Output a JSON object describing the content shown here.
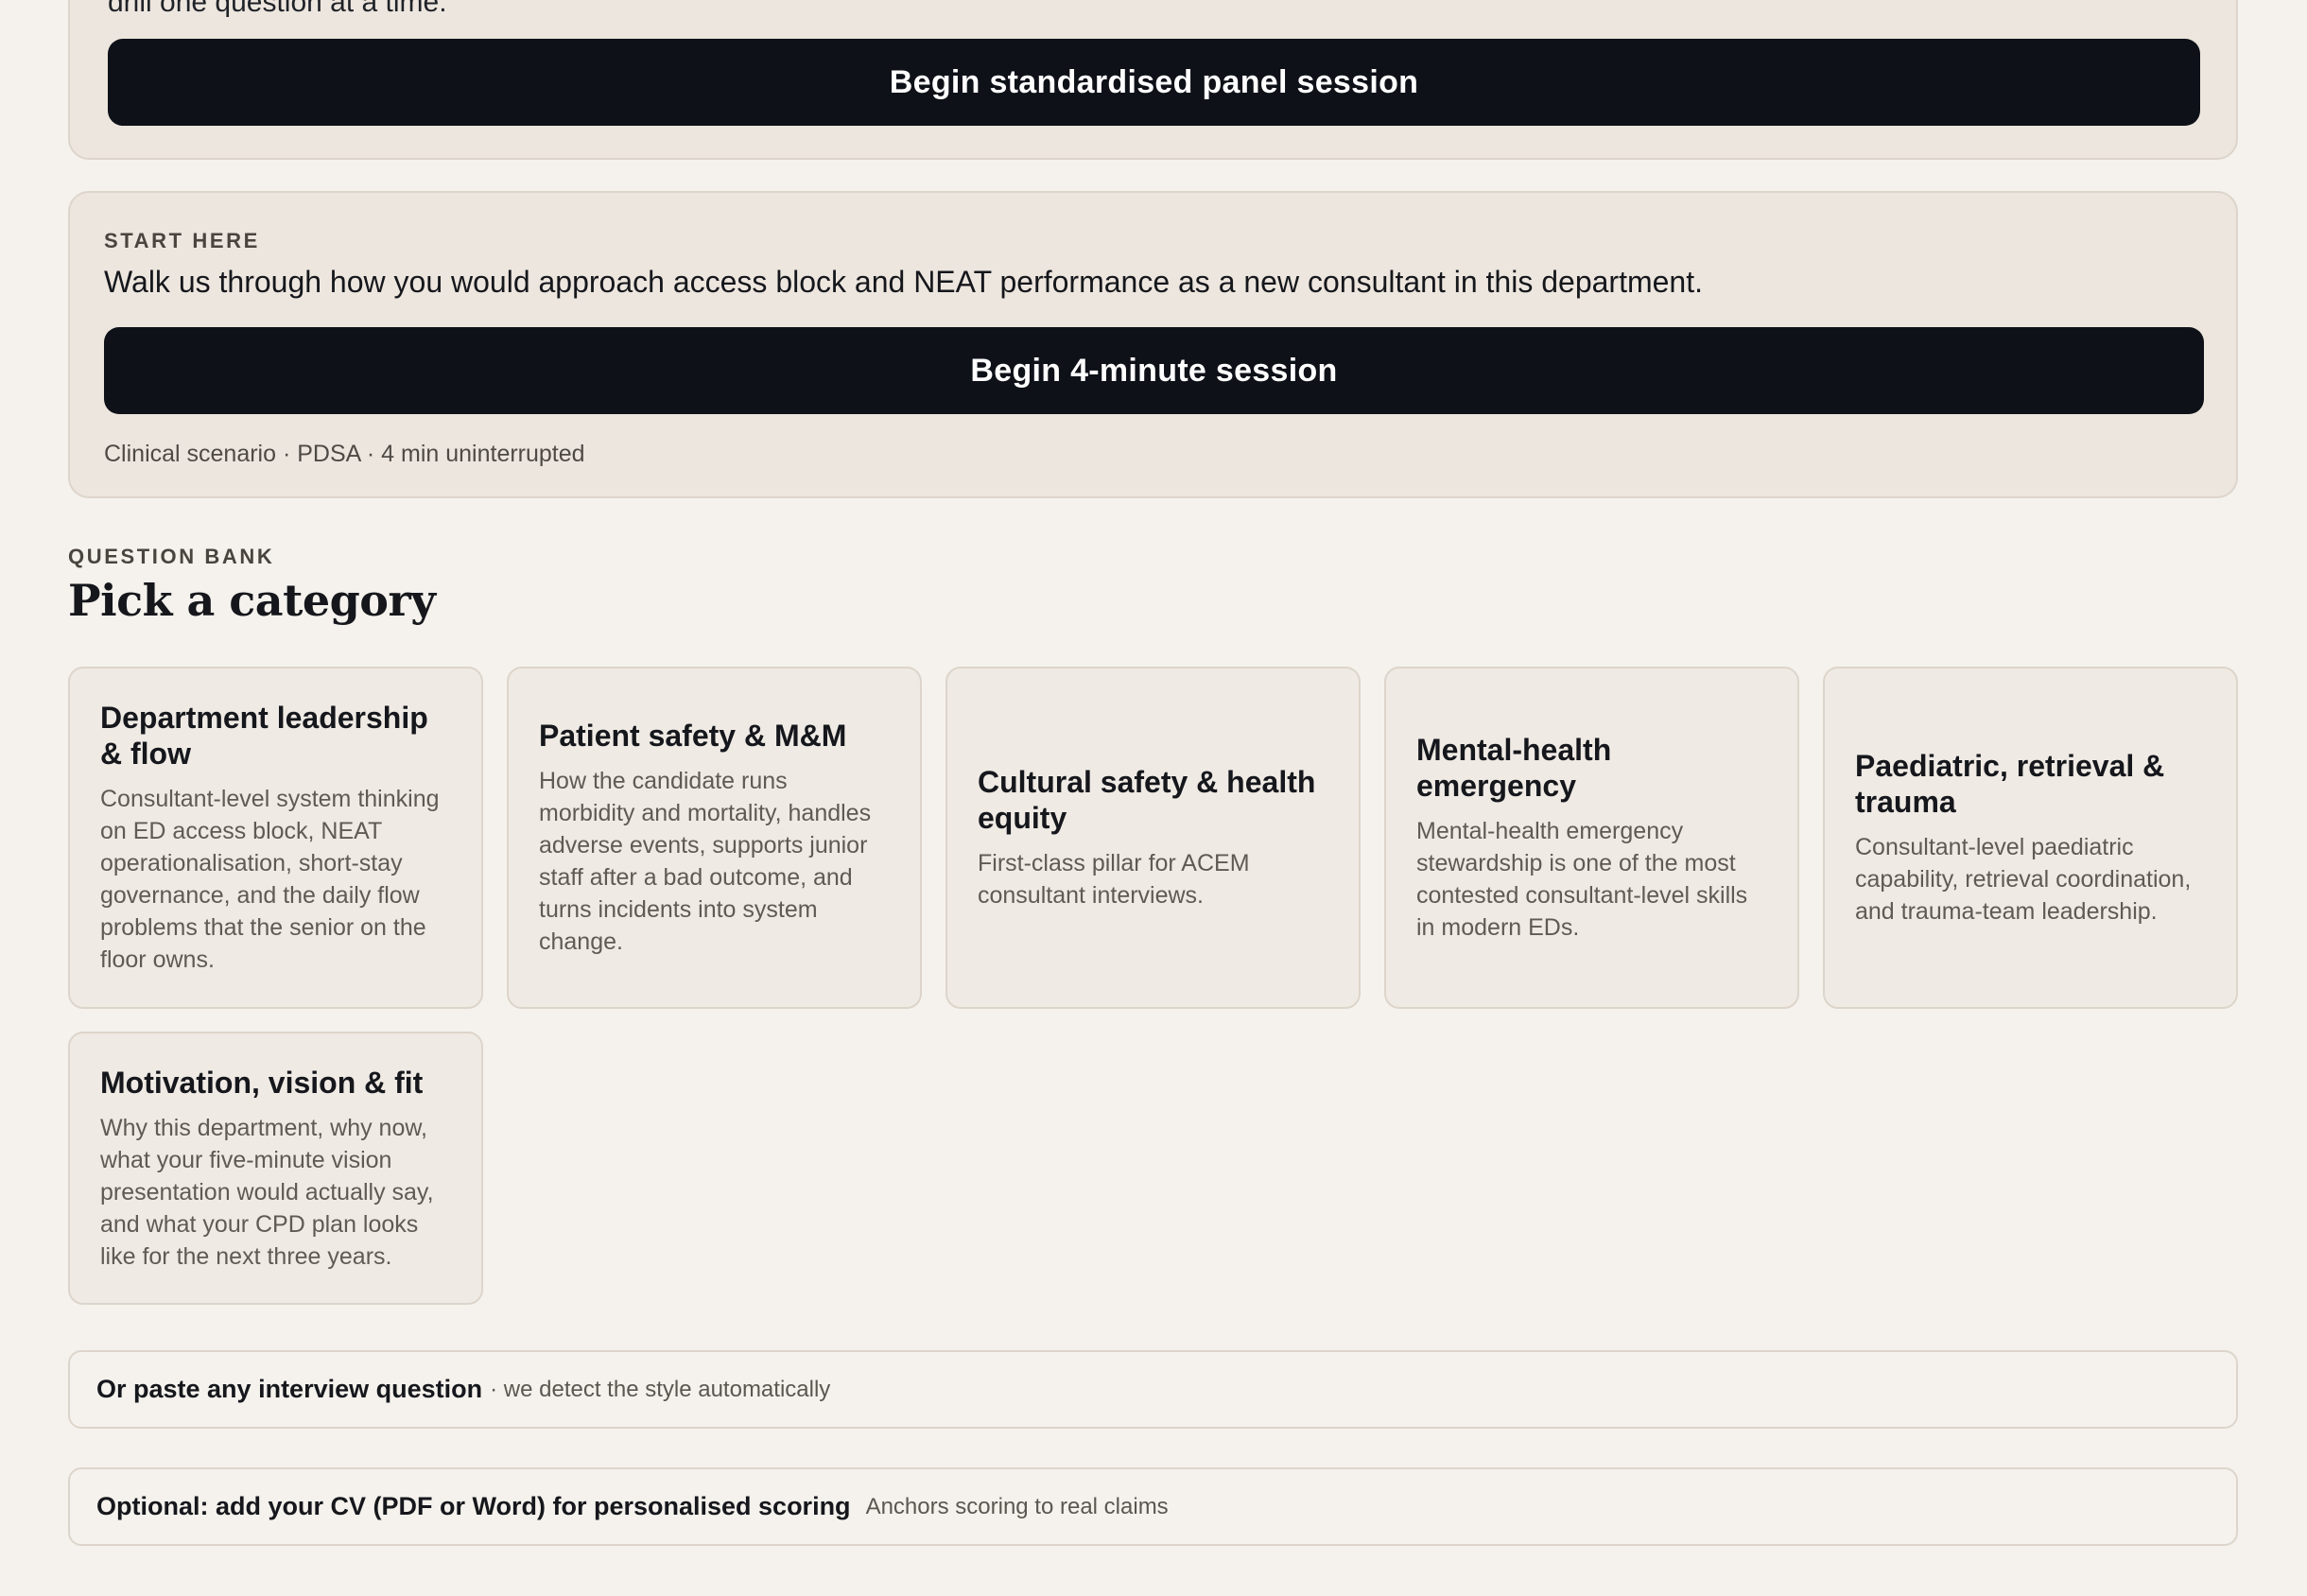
{
  "panel_top": {
    "cut_text": "drill one question at a time.",
    "button_label": "Begin standardised panel session"
  },
  "start_here": {
    "eyebrow": "START HERE",
    "question": "Walk us through how you would approach access block and NEAT performance as a new consultant in this department.",
    "button_label": "Begin 4-minute session",
    "meta": "Clinical scenario · PDSA · 4 min uninterrupted"
  },
  "question_bank": {
    "eyebrow": "QUESTION BANK",
    "title": "Pick a category",
    "categories": [
      {
        "title": "Department leadership & flow",
        "description": "Consultant-level system thinking on ED access block, NEAT operationalisation, short-stay governance, and the daily flow problems that the senior on the floor owns."
      },
      {
        "title": "Patient safety & M&M",
        "description": "How the candidate runs morbidity and mortality, handles adverse events, supports junior staff after a bad outcome, and turns incidents into system change."
      },
      {
        "title": "Cultural safety & health equity",
        "description": "First-class pillar for ACEM consultant interviews."
      },
      {
        "title": "Mental-health emergency",
        "description": "Mental-health emergency stewardship is one of the most contested consultant-level skills in modern EDs."
      },
      {
        "title": "Paediatric, retrieval & trauma",
        "description": "Consultant-level paediatric capability, retrieval coordination, and trauma-team leadership."
      },
      {
        "title": "Motivation, vision & fit",
        "description": "Why this department, why now, what your five-minute vision presentation would actually say, and what your CPD plan looks like for the next three years."
      }
    ]
  },
  "paste_row": {
    "label": "Or paste any interview question",
    "hint": "· we detect the style automatically"
  },
  "cv_row": {
    "label": "Optional: add your CV (PDF or Word) for personalised scoring",
    "hint": "Anchors scoring to real claims"
  }
}
